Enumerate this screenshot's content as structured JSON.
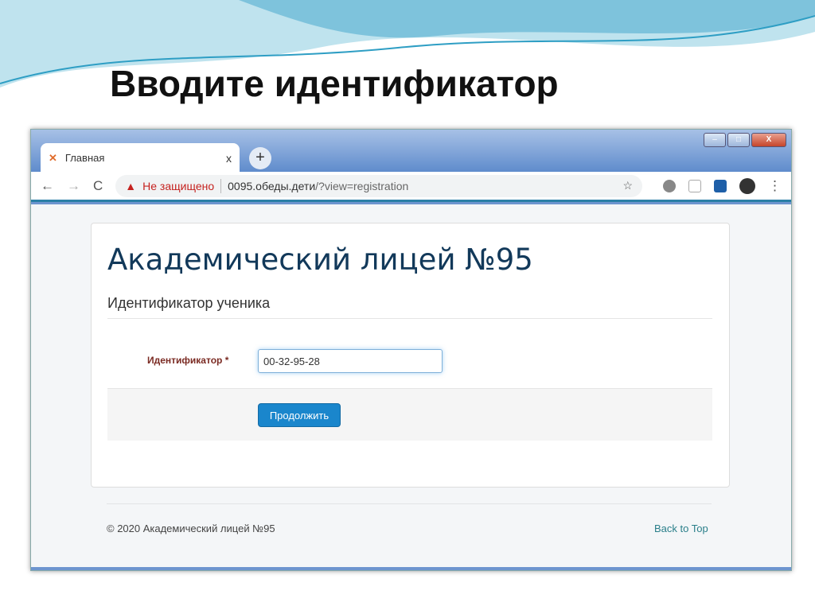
{
  "slide": {
    "title": "Вводите идентификатор"
  },
  "browser": {
    "tab": {
      "title": "Главная",
      "close": "x"
    },
    "new_tab": "+",
    "window_controls": {
      "minimize": "–",
      "maximize": "□",
      "close": "X"
    },
    "nav": {
      "back": "←",
      "forward": "→",
      "reload": "C"
    },
    "security": {
      "icon": "▲",
      "label": "Не защищено"
    },
    "url": {
      "host": "0095.обеды.дети",
      "path": "/?view=registration"
    },
    "star": "☆",
    "menu": "⋮"
  },
  "page": {
    "site_title": "Академический лицей №95",
    "form_legend": "Идентификатор ученика",
    "field_label": "Идентификатор *",
    "field_value": "00-32-95-28",
    "submit_label": "Продолжить",
    "footer_copyright": "© 2020 Академический лицей №95",
    "back_to_top": "Back to Top"
  }
}
